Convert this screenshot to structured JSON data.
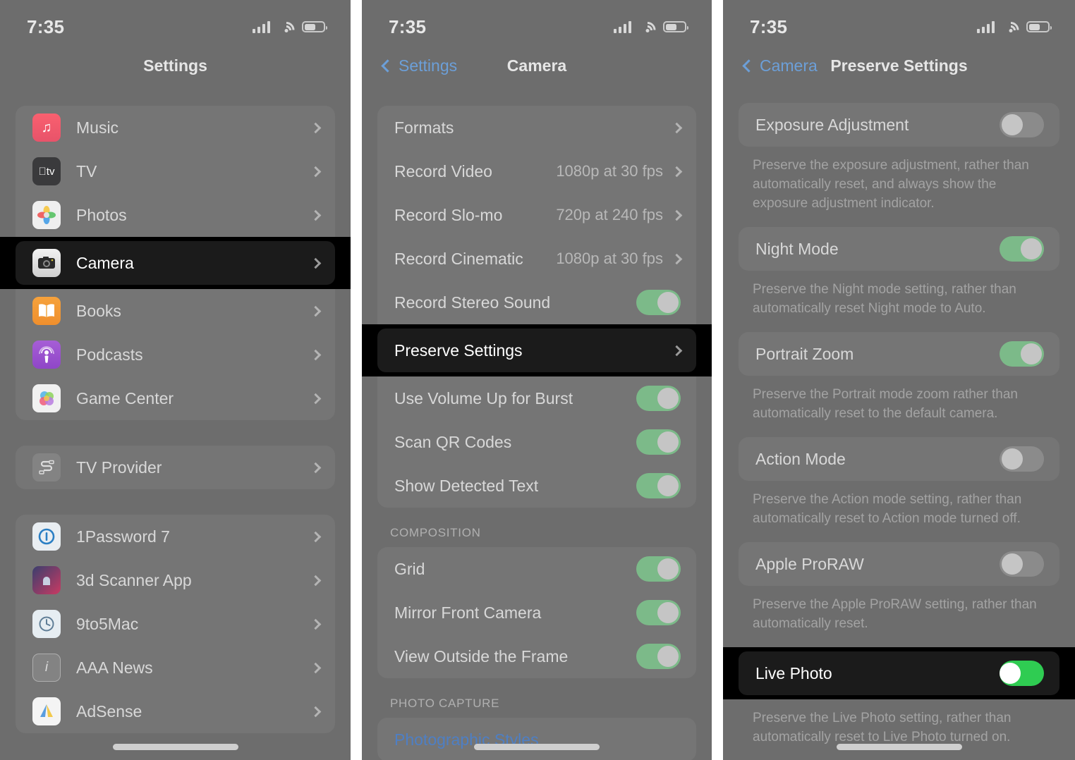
{
  "status_bar": {
    "time": "7:35",
    "signal_icon": "cellular-bars-icon",
    "wifi_icon": "wifi-icon",
    "battery_icon": "battery-icon"
  },
  "colors": {
    "panel_bg": "#6d6d6d",
    "card_bg": "rgba(255,255,255,0.055)",
    "accent_blue": "#6c9fd8",
    "toggle_on_dim": "#7cba89",
    "toggle_on_bright": "#34C759",
    "highlight_black": "#000000"
  },
  "panel_settings": {
    "nav": {
      "title": "Settings"
    },
    "group_apps": [
      {
        "label": "Music",
        "icon": "music-note-icon",
        "chevron": true
      },
      {
        "label": "TV",
        "icon": "apple-tv-icon",
        "chevron": true
      },
      {
        "label": "Photos",
        "icon": "photos-icon",
        "chevron": true
      },
      {
        "label": "Camera",
        "icon": "camera-icon",
        "chevron": true,
        "highlighted": true
      },
      {
        "label": "Books",
        "icon": "books-icon",
        "chevron": true
      },
      {
        "label": "Podcasts",
        "icon": "podcasts-icon",
        "chevron": true
      },
      {
        "label": "Game Center",
        "icon": "game-center-icon",
        "chevron": true
      }
    ],
    "group_provider": [
      {
        "label": "TV Provider",
        "icon": "tv-provider-icon",
        "chevron": true
      }
    ],
    "group_thirdparty": [
      {
        "label": "1Password 7",
        "icon": "1password-icon",
        "chevron": true
      },
      {
        "label": "3d Scanner App",
        "icon": "3d-scanner-icon",
        "chevron": true
      },
      {
        "label": "9to5Mac",
        "icon": "9to5mac-icon",
        "chevron": true
      },
      {
        "label": "AAA News",
        "icon": "aaa-news-icon",
        "chevron": true
      },
      {
        "label": "AdSense",
        "icon": "adsense-icon",
        "chevron": true
      }
    ]
  },
  "panel_camera": {
    "nav": {
      "back_label": "Settings",
      "title": "Camera",
      "back_icon": "chevron-left-icon"
    },
    "group_main": [
      {
        "label": "Formats",
        "type": "link",
        "value": "",
        "chevron": true
      },
      {
        "label": "Record Video",
        "type": "link",
        "value": "1080p at 30 fps",
        "chevron": true
      },
      {
        "label": "Record Slo-mo",
        "type": "link",
        "value": "720p at 240 fps",
        "chevron": true
      },
      {
        "label": "Record Cinematic",
        "type": "link",
        "value": "1080p at 30 fps",
        "chevron": true
      },
      {
        "label": "Record Stereo Sound",
        "type": "toggle",
        "on": true
      },
      {
        "label": "Preserve Settings",
        "type": "link",
        "value": "",
        "chevron": true,
        "highlighted": true
      },
      {
        "label": "Use Volume Up for Burst",
        "type": "toggle",
        "on": true
      },
      {
        "label": "Scan QR Codes",
        "type": "toggle",
        "on": true
      },
      {
        "label": "Show Detected Text",
        "type": "toggle",
        "on": true
      }
    ],
    "section_composition": {
      "header": "COMPOSITION",
      "rows": [
        {
          "label": "Grid",
          "type": "toggle",
          "on": true
        },
        {
          "label": "Mirror Front Camera",
          "type": "toggle",
          "on": true
        },
        {
          "label": "View Outside the Frame",
          "type": "toggle",
          "on": true
        }
      ]
    },
    "section_photo_capture": {
      "header": "PHOTO CAPTURE",
      "rows": [
        {
          "label": "Photographic Styles",
          "type": "link-blue"
        }
      ]
    }
  },
  "panel_preserve": {
    "nav": {
      "back_label": "Camera",
      "title": "Preserve Settings",
      "back_icon": "chevron-left-icon"
    },
    "items": [
      {
        "label": "Exposure Adjustment",
        "on": false,
        "footnote": "Preserve the exposure adjustment, rather than automatically reset, and always show the exposure adjustment indicator."
      },
      {
        "label": "Night Mode",
        "on": true,
        "footnote": "Preserve the Night mode setting, rather than automatically reset Night mode to Auto."
      },
      {
        "label": "Portrait Zoom",
        "on": true,
        "footnote": "Preserve the Portrait mode zoom rather than automatically reset to the default camera."
      },
      {
        "label": "Action Mode",
        "on": false,
        "footnote": "Preserve the Action mode setting, rather than automatically reset to Action mode turned off."
      },
      {
        "label": "Apple ProRAW",
        "on": false,
        "footnote": "Preserve the Apple ProRAW setting, rather than automatically reset."
      },
      {
        "label": "Live Photo",
        "on": true,
        "highlighted": true,
        "footnote": "Preserve the Live Photo setting, rather than automatically reset to Live Photo turned on."
      }
    ]
  }
}
